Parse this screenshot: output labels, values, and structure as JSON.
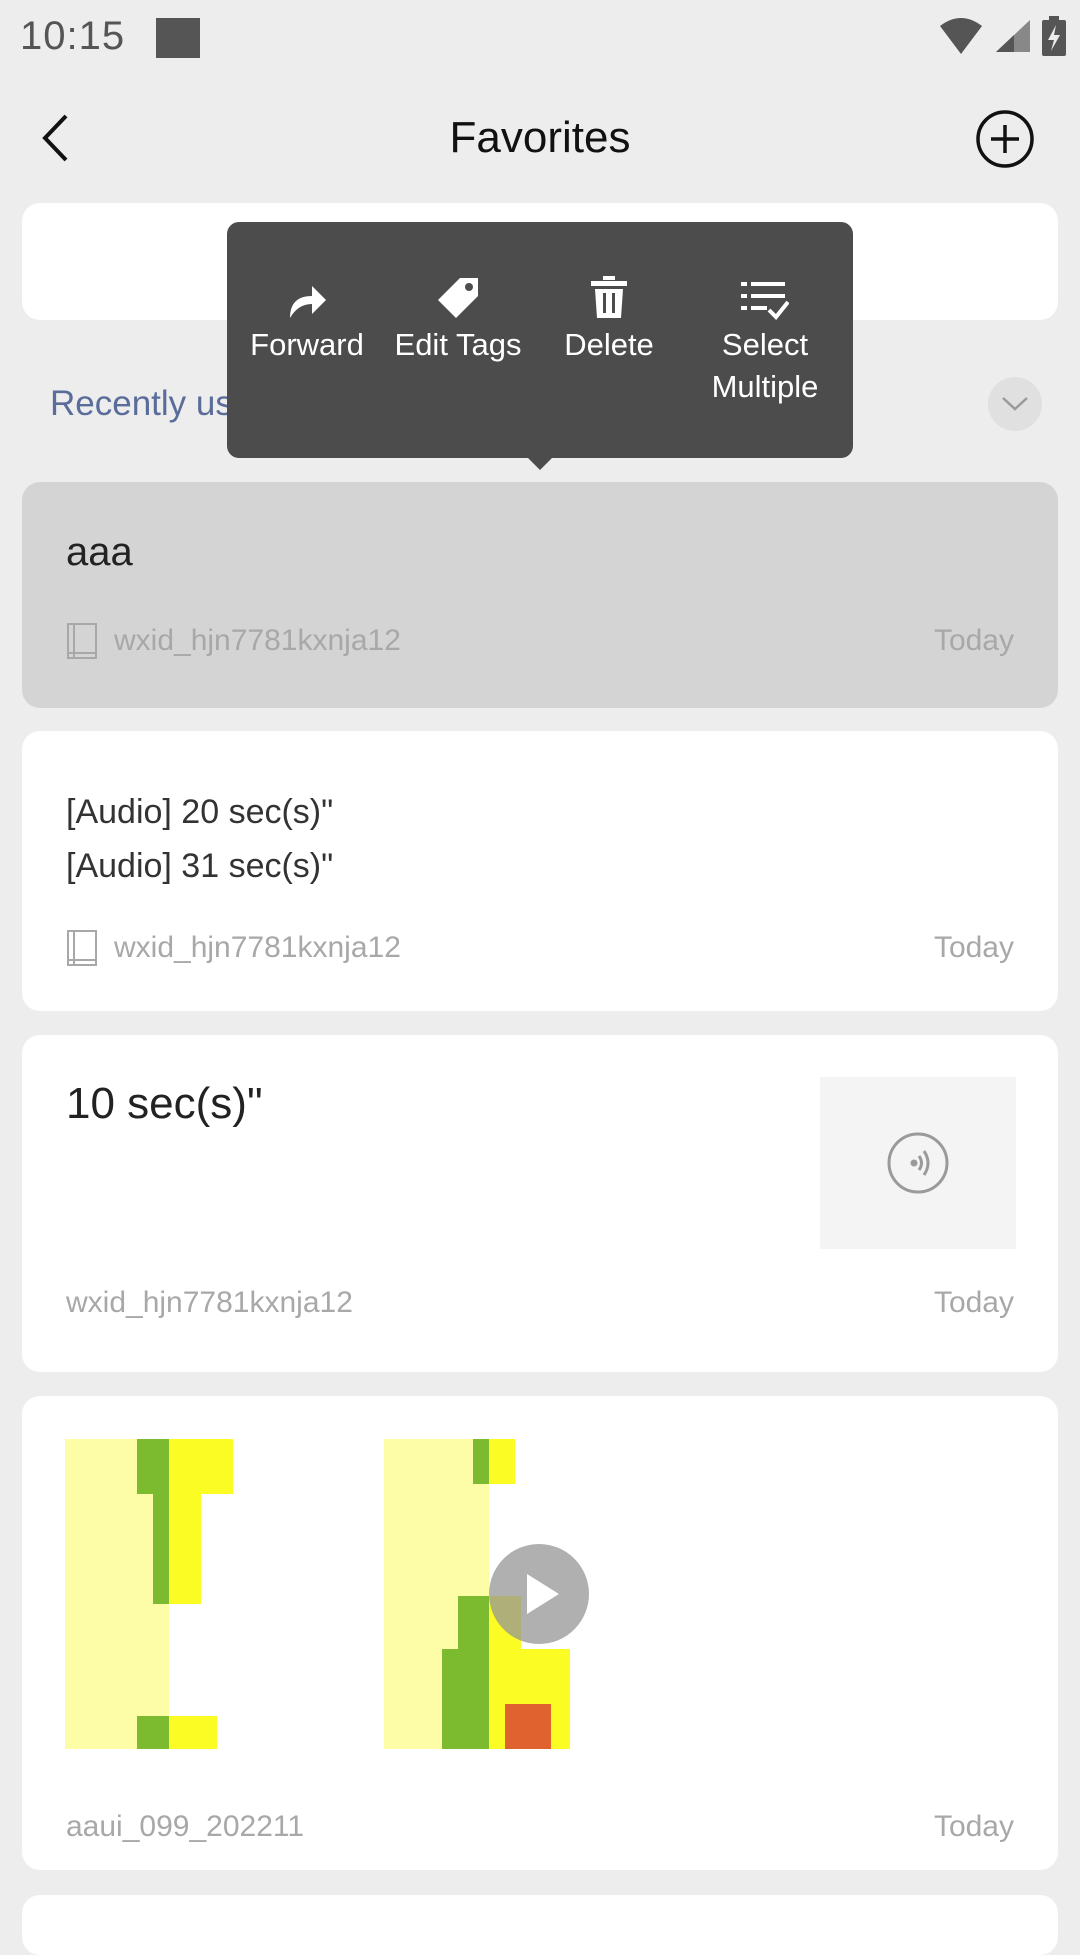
{
  "status_bar": {
    "time": "10:15"
  },
  "header": {
    "title": "Favorites"
  },
  "recently_used": {
    "label": "Recently us"
  },
  "context_menu": {
    "items": [
      {
        "label": "Forward",
        "icon": "forward-arrow-icon"
      },
      {
        "label": "Edit Tags",
        "icon": "tag-icon"
      },
      {
        "label": "Delete",
        "icon": "trash-icon"
      },
      {
        "label": "Select\nMultiple",
        "icon": "checklist-icon"
      }
    ]
  },
  "favorites": [
    {
      "text": "aaa",
      "source": "wxid_hjn7781kxnja12",
      "date": "Today",
      "selected": true
    },
    {
      "lines": [
        "[Audio] 20 sec(s)\"",
        "[Audio] 31 sec(s)\""
      ],
      "source": "wxid_hjn7781kxnja12",
      "date": "Today"
    },
    {
      "text": "10 sec(s)\"",
      "source": "wxid_hjn7781kxnja12",
      "date": "Today",
      "thumb_icon": "audio-wave-icon"
    },
    {
      "source": "aaui_099_202211",
      "date": "Today",
      "media": [
        "image",
        "video"
      ]
    }
  ],
  "colors": {
    "background": "#ededed",
    "card": "#ffffff",
    "selected_card": "#d4d4d4",
    "menu": "#4c4c4c",
    "accent_link": "#5a6c99",
    "thumb_light_yellow": "#fdfda8",
    "thumb_yellow": "#fcfc25",
    "thumb_green": "#7cba2f",
    "thumb_orange": "#e0622e"
  }
}
